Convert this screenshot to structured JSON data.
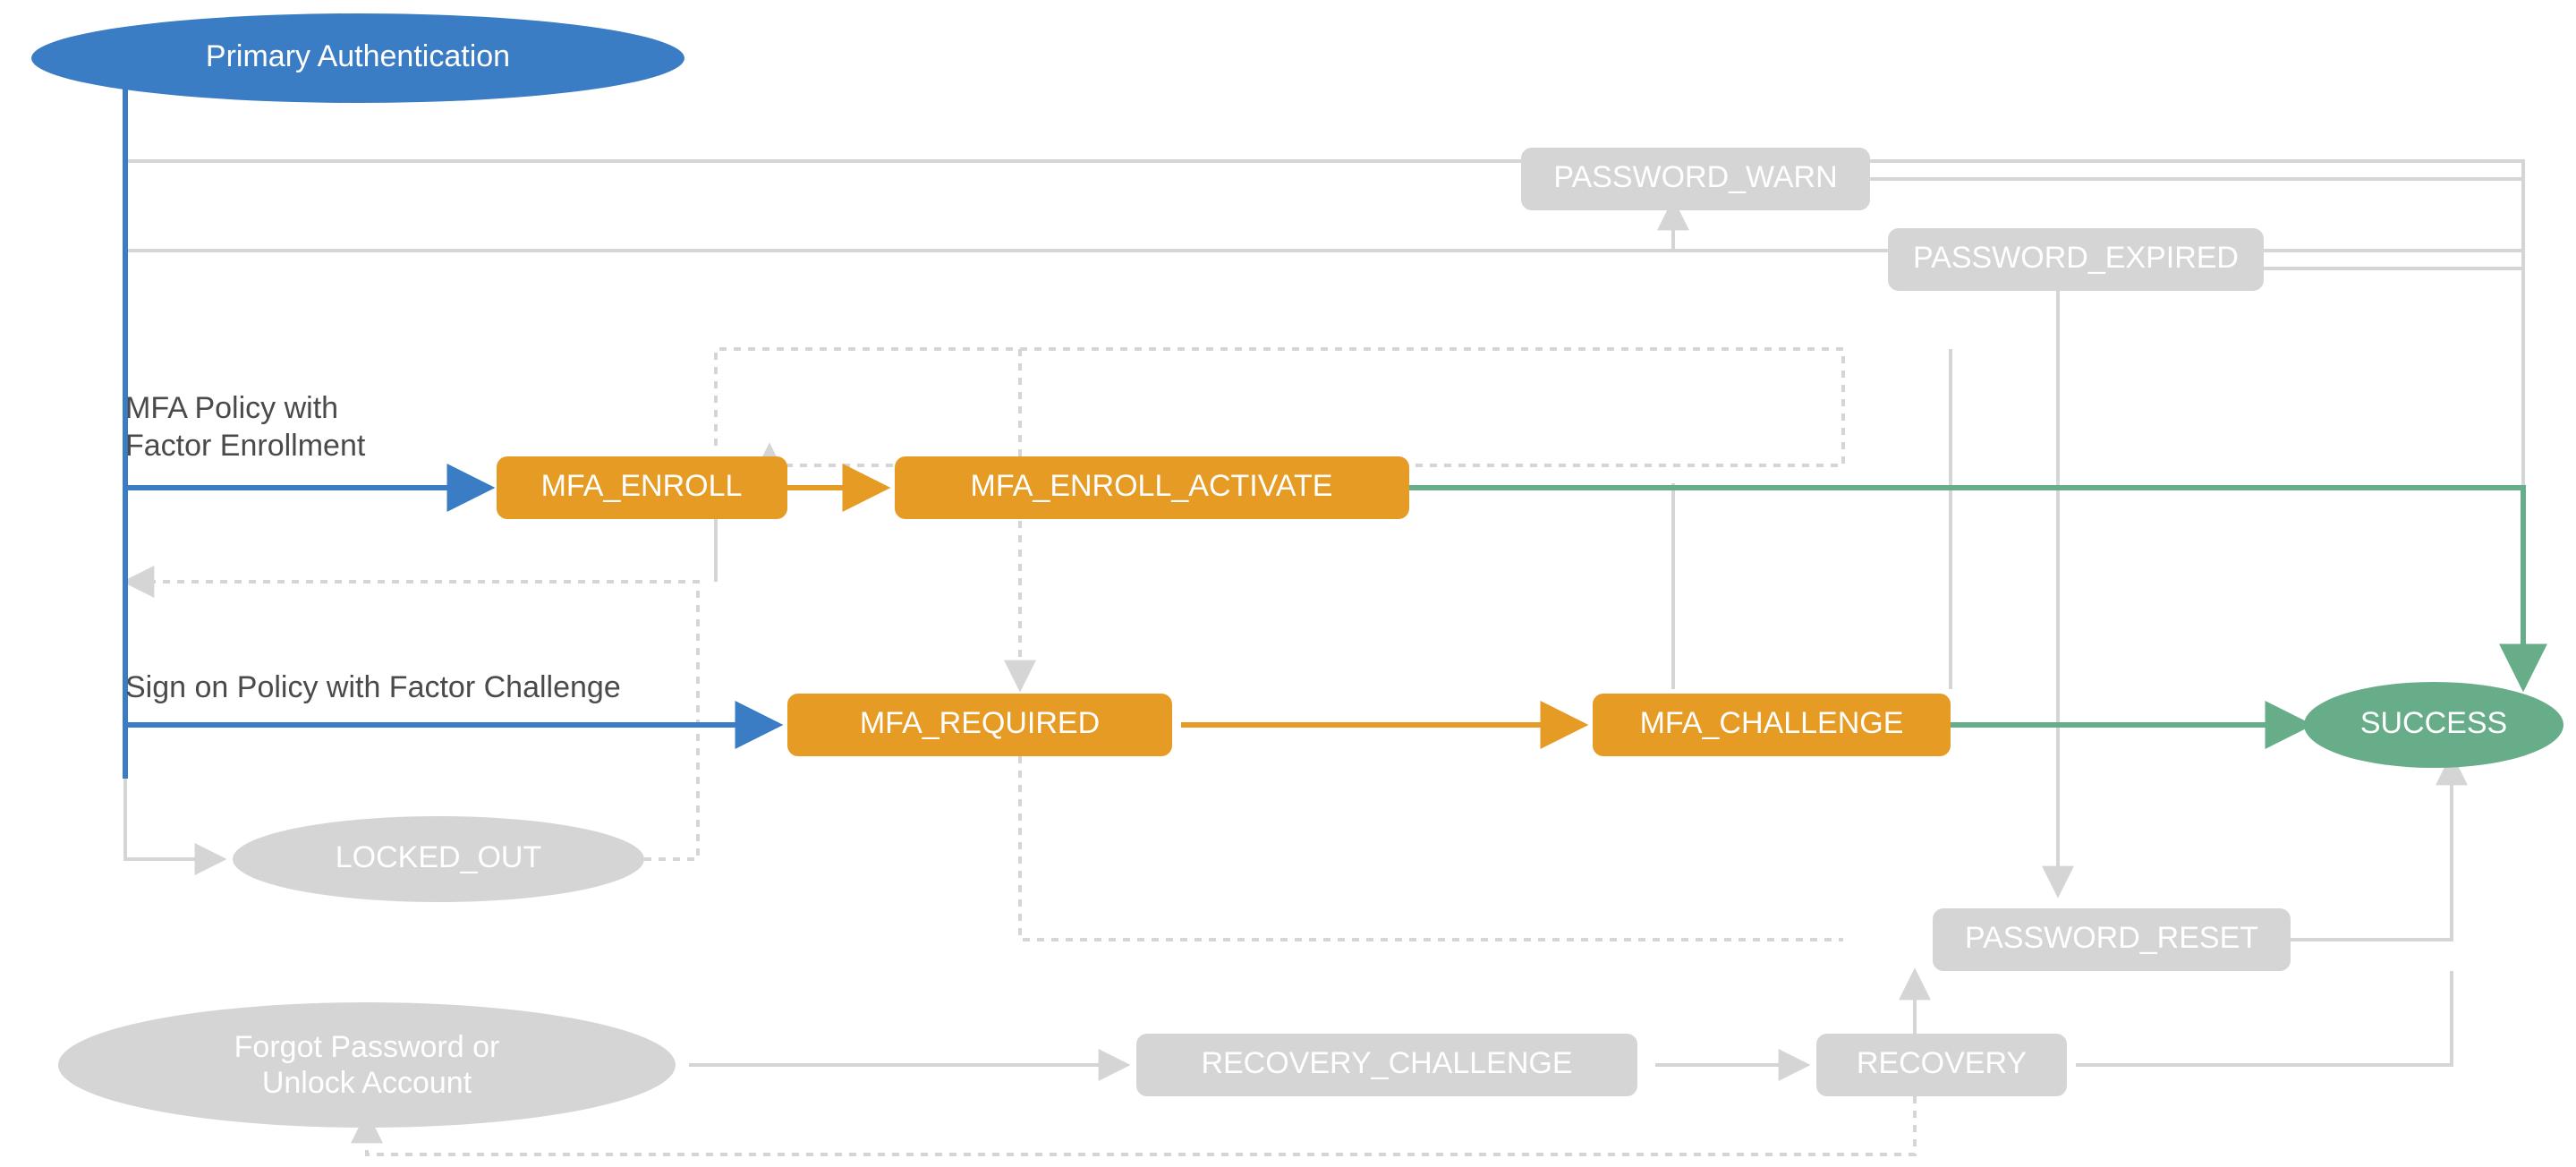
{
  "colors": {
    "blue_fill": "#3b7dc4",
    "orange_fill": "#e69b24",
    "green_fill": "#67ad8a",
    "inactive_fill": "#d5d5d5",
    "inactive_text": "#ffffff",
    "edge_blue": "#3b7dc4",
    "edge_orange": "#e69b24",
    "edge_green": "#67ad8a",
    "edge_inactive": "#d5d5d5",
    "label_text": "#4a4a4a"
  },
  "nodes": {
    "primary_auth": "Primary Authentication",
    "mfa_enroll": "MFA_ENROLL",
    "mfa_enroll_activate": "MFA_ENROLL_ACTIVATE",
    "mfa_required": "MFA_REQUIRED",
    "mfa_challenge": "MFA_CHALLENGE",
    "success": "SUCCESS",
    "password_warn": "PASSWORD_WARN",
    "password_expired": "PASSWORD_EXPIRED",
    "password_reset": "PASSWORD_RESET",
    "locked_out": "LOCKED_OUT",
    "recovery_challenge": "RECOVERY_CHALLENGE",
    "recovery": "RECOVERY",
    "forgot": "Forgot Password or",
    "forgot2": "Unlock Account"
  },
  "labels": {
    "mfa_policy_l1": "MFA Policy with",
    "mfa_policy_l2": "Factor Enrollment",
    "signon_policy": "Sign on Policy with Factor Challenge"
  },
  "diagram_meta": {
    "type": "state-transition",
    "start_node": "Primary Authentication",
    "end_node": "SUCCESS",
    "highlighted_paths": [
      [
        "Primary Authentication",
        "MFA_ENROLL",
        "MFA_ENROLL_ACTIVATE",
        "SUCCESS"
      ],
      [
        "Primary Authentication",
        "MFA_REQUIRED",
        "MFA_CHALLENGE",
        "SUCCESS"
      ]
    ],
    "inactive_nodes": [
      "PASSWORD_WARN",
      "PASSWORD_EXPIRED",
      "PASSWORD_RESET",
      "LOCKED_OUT",
      "RECOVERY_CHALLENGE",
      "RECOVERY",
      "Forgot Password or Unlock Account"
    ]
  }
}
